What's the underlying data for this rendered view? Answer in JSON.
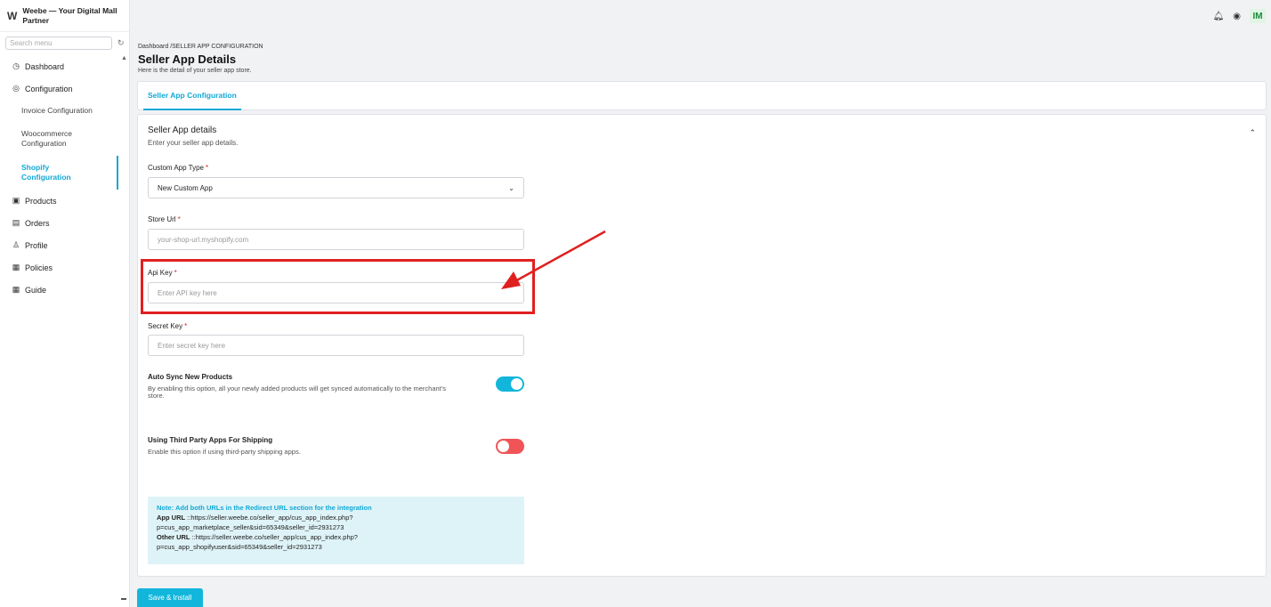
{
  "app": {
    "logo": "W",
    "name": "Weebe — Your Digital Mall Partner"
  },
  "sidebar": {
    "search_placeholder": "Search menu",
    "items": [
      {
        "label": "Dashboard",
        "icon": "dashboard-icon"
      },
      {
        "label": "Configuration",
        "icon": "settings-icon"
      },
      {
        "label": "Invoice Configuration"
      },
      {
        "label": "Woocommerce Configuration"
      },
      {
        "label": "Shopify Configuration",
        "active": true
      },
      {
        "label": "Products",
        "icon": "products-icon"
      },
      {
        "label": "Orders",
        "icon": "orders-icon"
      },
      {
        "label": "Profile",
        "icon": "profile-icon"
      },
      {
        "label": "Policies",
        "icon": "policies-icon"
      },
      {
        "label": "Guide",
        "icon": "guide-icon"
      }
    ]
  },
  "topbar": {
    "avatar_initials": "IM"
  },
  "header": {
    "breadcrumb": "Dashboard /SELLER APP CONFIGURATION",
    "title": "Seller App Details",
    "subtitle": "Here is the detail of your seller app store."
  },
  "tabs": [
    {
      "label": "Seller App Configuration",
      "active": true
    }
  ],
  "card": {
    "title": "Seller App details",
    "description": "Enter your seller app details."
  },
  "form": {
    "app_type": {
      "label": "Custom App Type",
      "required": "*",
      "value": "New Custom App"
    },
    "store_url": {
      "label": "Store Url",
      "required": "*",
      "placeholder": "your-shop-url.myshopify.com"
    },
    "api_key": {
      "label": "Api Key",
      "required": "*",
      "placeholder": "Enter API key here"
    },
    "secret_key": {
      "label": "Secret Key",
      "required": "*",
      "placeholder": "Enter secret key here"
    },
    "auto_sync": {
      "title": "Auto Sync New Products",
      "description": "By enabling this option, all your newly added products will get synced automatically to the merchant's store.",
      "enabled": true
    },
    "third_party": {
      "title": "Using Third Party Apps For Shipping",
      "description": "Enable this option if using third-party shipping apps.",
      "enabled": false
    }
  },
  "note": {
    "title": "Note: Add both URLs in the Redirect URL section for the integration",
    "app_url_label": "App URL",
    "app_url_line1": " ::https://seller.weebe.co/seller_app/cus_app_index.php?",
    "app_url_line2": "p=cus_app_marketplace_seller&sid=65349&seller_id=2931273",
    "other_url_label": "Other URL",
    "other_url_line1": " ::https://seller.weebe.co/seller_app/cus_app_index.php?",
    "other_url_line2": "p=cus_app_shopifyuser&sid=65349&seller_id=2931273"
  },
  "actions": {
    "save_label": "Save & Install"
  },
  "colors": {
    "accent": "#12b6db",
    "toggle_off": "#f05456",
    "annotation": "#e02020"
  }
}
